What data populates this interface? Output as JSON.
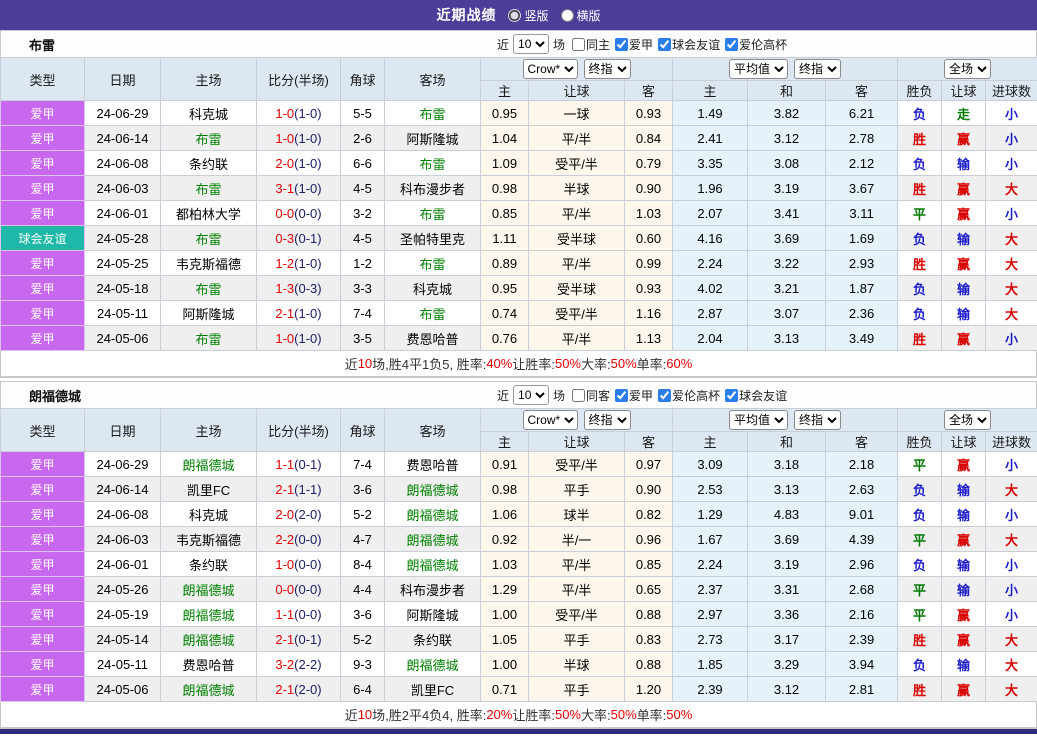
{
  "top_bar": {
    "title": "近期战绩",
    "options": [
      {
        "label": "竖版",
        "selected": true
      },
      {
        "label": "横版",
        "selected": false
      }
    ]
  },
  "table_header": {
    "static": [
      "类型",
      "日期",
      "主场",
      "比分(半场)",
      "角球",
      "客场"
    ],
    "group1": {
      "dropdowns": [
        "Crow*",
        "终指"
      ],
      "cols": [
        "主",
        "让球",
        "客"
      ]
    },
    "group2": {
      "dropdowns": [
        "平均值",
        "终指"
      ],
      "cols": [
        "主",
        "和",
        "客"
      ]
    },
    "group3": {
      "dropdowns": [
        "全场"
      ],
      "cols": [
        "胜负",
        "让球",
        "进球数"
      ]
    }
  },
  "result_colors": {
    "胜": "#d90000",
    "负": "#1d1dcc",
    "平": "#007a00",
    "赢": "#d90000",
    "输": "#1d1dcc",
    "走": "#007a00",
    "大": "#d90000",
    "小": "#1d1dcc"
  },
  "type_colors": {
    "爱甲": "#c868ef",
    "球会友谊": "#1fb8a8"
  },
  "sections": [
    {
      "team": "布雷",
      "filter": {
        "prefix": "近",
        "count": "10",
        "suffix": "场",
        "uncheck_label": "同主",
        "checked_labels": [
          "爱甲",
          "球会友谊",
          "爱伦高杯"
        ]
      },
      "rows": [
        {
          "type": "爱甲",
          "date": "24-06-29",
          "home": "科克城",
          "home_team": false,
          "score": "1-0",
          "half": "(1-0)",
          "corner": "5-5",
          "away": "布雷",
          "away_team": true,
          "odds": [
            "0.95",
            "一球",
            "0.93"
          ],
          "avg": [
            "1.49",
            "3.82",
            "6.21"
          ],
          "results": [
            "负",
            "走",
            "小"
          ]
        },
        {
          "type": "爱甲",
          "date": "24-06-14",
          "home": "布雷",
          "home_team": true,
          "score": "1-0",
          "half": "(1-0)",
          "corner": "2-6",
          "away": "阿斯隆城",
          "away_team": false,
          "odds": [
            "1.04",
            "平/半",
            "0.84"
          ],
          "avg": [
            "2.41",
            "3.12",
            "2.78"
          ],
          "results": [
            "胜",
            "赢",
            "小"
          ]
        },
        {
          "type": "爱甲",
          "date": "24-06-08",
          "home": "条约联",
          "home_team": false,
          "score": "2-0",
          "half": "(1-0)",
          "corner": "6-6",
          "away": "布雷",
          "away_team": true,
          "odds": [
            "1.09",
            "受平/半",
            "0.79"
          ],
          "avg": [
            "3.35",
            "3.08",
            "2.12"
          ],
          "results": [
            "负",
            "输",
            "小"
          ]
        },
        {
          "type": "爱甲",
          "date": "24-06-03",
          "home": "布雷",
          "home_team": true,
          "score": "3-1",
          "half": "(1-0)",
          "corner": "4-5",
          "away": "科布漫步者",
          "away_team": false,
          "odds": [
            "0.98",
            "半球",
            "0.90"
          ],
          "avg": [
            "1.96",
            "3.19",
            "3.67"
          ],
          "results": [
            "胜",
            "赢",
            "大"
          ]
        },
        {
          "type": "爱甲",
          "date": "24-06-01",
          "home": "都柏林大学",
          "home_team": false,
          "score": "0-0",
          "half": "(0-0)",
          "corner": "3-2",
          "away": "布雷",
          "away_team": true,
          "odds": [
            "0.85",
            "平/半",
            "1.03"
          ],
          "avg": [
            "2.07",
            "3.41",
            "3.11"
          ],
          "results": [
            "平",
            "赢",
            "小"
          ]
        },
        {
          "type": "球会友谊",
          "date": "24-05-28",
          "home": "布雷",
          "home_team": true,
          "score": "0-3",
          "half": "(0-1)",
          "corner": "4-5",
          "away": "圣帕特里克",
          "away_team": false,
          "odds": [
            "1.11",
            "受半球",
            "0.60"
          ],
          "avg": [
            "4.16",
            "3.69",
            "1.69"
          ],
          "results": [
            "负",
            "输",
            "大"
          ]
        },
        {
          "type": "爱甲",
          "date": "24-05-25",
          "home": "韦克斯福德",
          "home_team": false,
          "score": "1-2",
          "half": "(1-0)",
          "corner": "1-2",
          "away": "布雷",
          "away_team": true,
          "odds": [
            "0.89",
            "平/半",
            "0.99"
          ],
          "avg": [
            "2.24",
            "3.22",
            "2.93"
          ],
          "results": [
            "胜",
            "赢",
            "大"
          ]
        },
        {
          "type": "爱甲",
          "date": "24-05-18",
          "home": "布雷",
          "home_team": true,
          "score": "1-3",
          "half": "(0-3)",
          "corner": "3-3",
          "away": "科克城",
          "away_team": false,
          "odds": [
            "0.95",
            "受半球",
            "0.93"
          ],
          "avg": [
            "4.02",
            "3.21",
            "1.87"
          ],
          "results": [
            "负",
            "输",
            "大"
          ]
        },
        {
          "type": "爱甲",
          "date": "24-05-11",
          "home": "阿斯隆城",
          "home_team": false,
          "score": "2-1",
          "half": "(1-0)",
          "corner": "7-4",
          "away": "布雷",
          "away_team": true,
          "odds": [
            "0.74",
            "受平/半",
            "1.16"
          ],
          "avg": [
            "2.87",
            "3.07",
            "2.36"
          ],
          "results": [
            "负",
            "输",
            "大"
          ]
        },
        {
          "type": "爱甲",
          "date": "24-05-06",
          "home": "布雷",
          "home_team": true,
          "score": "1-0",
          "half": "(1-0)",
          "corner": "3-5",
          "away": "费恩哈普",
          "away_team": false,
          "odds": [
            "0.76",
            "平/半",
            "1.13"
          ],
          "avg": [
            "2.04",
            "3.13",
            "3.49"
          ],
          "results": [
            "胜",
            "赢",
            "小"
          ]
        }
      ],
      "summary": [
        {
          "t": "近",
          "red": false
        },
        {
          "t": "10",
          "red": true
        },
        {
          "t": "场,胜4平1负5, 胜率:",
          "red": false
        },
        {
          "t": "40%",
          "red": true
        },
        {
          "t": " 让胜率:",
          "red": false
        },
        {
          "t": "50%",
          "red": true
        },
        {
          "t": " 大率:",
          "red": false
        },
        {
          "t": "50%",
          "red": true
        },
        {
          "t": " 单率:",
          "red": false
        },
        {
          "t": "60%",
          "red": true
        }
      ]
    },
    {
      "team": "朗福德城",
      "filter": {
        "prefix": "近",
        "count": "10",
        "suffix": "场",
        "uncheck_label": "同客",
        "checked_labels": [
          "爱甲",
          "爱伦高杯",
          "球会友谊"
        ]
      },
      "rows": [
        {
          "type": "爱甲",
          "date": "24-06-29",
          "home": "朗福德城",
          "home_team": true,
          "score": "1-1",
          "half": "(0-1)",
          "corner": "7-4",
          "away": "费恩哈普",
          "away_team": false,
          "odds": [
            "0.91",
            "受平/半",
            "0.97"
          ],
          "avg": [
            "3.09",
            "3.18",
            "2.18"
          ],
          "results": [
            "平",
            "赢",
            "小"
          ]
        },
        {
          "type": "爱甲",
          "date": "24-06-14",
          "home": "凯里FC",
          "home_team": false,
          "score": "2-1",
          "half": "(1-1)",
          "corner": "3-6",
          "away": "朗福德城",
          "away_team": true,
          "odds": [
            "0.98",
            "平手",
            "0.90"
          ],
          "avg": [
            "2.53",
            "3.13",
            "2.63"
          ],
          "results": [
            "负",
            "输",
            "大"
          ]
        },
        {
          "type": "爱甲",
          "date": "24-06-08",
          "home": "科克城",
          "home_team": false,
          "score": "2-0",
          "half": "(2-0)",
          "corner": "5-2",
          "away": "朗福德城",
          "away_team": true,
          "odds": [
            "1.06",
            "球半",
            "0.82"
          ],
          "avg": [
            "1.29",
            "4.83",
            "9.01"
          ],
          "results": [
            "负",
            "输",
            "小"
          ]
        },
        {
          "type": "爱甲",
          "date": "24-06-03",
          "home": "韦克斯福德",
          "home_team": false,
          "score": "2-2",
          "half": "(0-0)",
          "corner": "4-7",
          "away": "朗福德城",
          "away_team": true,
          "odds": [
            "0.92",
            "半/一",
            "0.96"
          ],
          "avg": [
            "1.67",
            "3.69",
            "4.39"
          ],
          "results": [
            "平",
            "赢",
            "大"
          ]
        },
        {
          "type": "爱甲",
          "date": "24-06-01",
          "home": "条约联",
          "home_team": false,
          "score": "1-0",
          "half": "(0-0)",
          "corner": "8-4",
          "away": "朗福德城",
          "away_team": true,
          "odds": [
            "1.03",
            "平/半",
            "0.85"
          ],
          "avg": [
            "2.24",
            "3.19",
            "2.96"
          ],
          "results": [
            "负",
            "输",
            "小"
          ]
        },
        {
          "type": "爱甲",
          "date": "24-05-26",
          "home": "朗福德城",
          "home_team": true,
          "score": "0-0",
          "half": "(0-0)",
          "corner": "4-4",
          "away": "科布漫步者",
          "away_team": false,
          "odds": [
            "1.29",
            "平/半",
            "0.65"
          ],
          "avg": [
            "2.37",
            "3.31",
            "2.68"
          ],
          "results": [
            "平",
            "输",
            "小"
          ]
        },
        {
          "type": "爱甲",
          "date": "24-05-19",
          "home": "朗福德城",
          "home_team": true,
          "score": "1-1",
          "half": "(0-0)",
          "corner": "3-6",
          "away": "阿斯隆城",
          "away_team": false,
          "odds": [
            "1.00",
            "受平/半",
            "0.88"
          ],
          "avg": [
            "2.97",
            "3.36",
            "2.16"
          ],
          "results": [
            "平",
            "赢",
            "小"
          ]
        },
        {
          "type": "爱甲",
          "date": "24-05-14",
          "home": "朗福德城",
          "home_team": true,
          "score": "2-1",
          "half": "(0-1)",
          "corner": "5-2",
          "away": "条约联",
          "away_team": false,
          "odds": [
            "1.05",
            "平手",
            "0.83"
          ],
          "avg": [
            "2.73",
            "3.17",
            "2.39"
          ],
          "results": [
            "胜",
            "赢",
            "大"
          ]
        },
        {
          "type": "爱甲",
          "date": "24-05-11",
          "home": "费恩哈普",
          "home_team": false,
          "score": "3-2",
          "half": "(2-2)",
          "corner": "9-3",
          "away": "朗福德城",
          "away_team": true,
          "odds": [
            "1.00",
            "半球",
            "0.88"
          ],
          "avg": [
            "1.85",
            "3.29",
            "3.94"
          ],
          "results": [
            "负",
            "输",
            "大"
          ]
        },
        {
          "type": "爱甲",
          "date": "24-05-06",
          "home": "朗福德城",
          "home_team": true,
          "score": "2-1",
          "half": "(2-0)",
          "corner": "6-4",
          "away": "凯里FC",
          "away_team": false,
          "odds": [
            "0.71",
            "平手",
            "1.20"
          ],
          "avg": [
            "2.39",
            "3.12",
            "2.81"
          ],
          "results": [
            "胜",
            "赢",
            "大"
          ]
        }
      ],
      "summary": [
        {
          "t": "近",
          "red": false
        },
        {
          "t": "10",
          "red": true
        },
        {
          "t": "场,胜2平4负4, 胜率:",
          "red": false
        },
        {
          "t": "20%",
          "red": true
        },
        {
          "t": " 让胜率:",
          "red": false
        },
        {
          "t": "50%",
          "red": true
        },
        {
          "t": " 大率:",
          "red": false
        },
        {
          "t": "50%",
          "red": true
        },
        {
          "t": " 单率:",
          "red": false
        },
        {
          "t": "50%",
          "red": true
        }
      ]
    }
  ]
}
